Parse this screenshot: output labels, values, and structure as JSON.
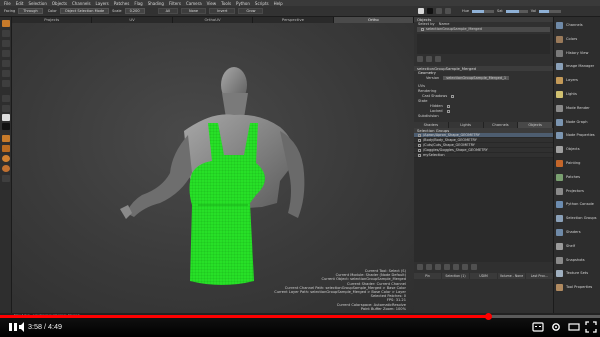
{
  "menu": [
    "File",
    "Edit",
    "Selection",
    "Objects",
    "Channels",
    "Layers",
    "Patches",
    "Flag",
    "Shading",
    "Filters",
    "Camera",
    "View",
    "Tools",
    "Python",
    "Scripts",
    "Help"
  ],
  "toolbar": {
    "facing_label": "Facing",
    "facing_value": "Through",
    "color_label": "Color",
    "color_value": "Object Selection Mode",
    "scale_label": "Scale",
    "scale_value": "0.200",
    "seg_all": "All",
    "seg_none": "None",
    "seg_invert": "Invert",
    "seg_grow": "Grow"
  },
  "right_toolbar": {
    "hue_label": "Hue",
    "sat_label": "Sat",
    "val_label": "Val",
    "hue": 0.55,
    "sat": 0.6,
    "val": 0.45
  },
  "view_tabs": [
    {
      "label": "Projects"
    },
    {
      "label": "UV"
    },
    {
      "label": "OrthoUV"
    },
    {
      "label": "Perspective"
    },
    {
      "label": "Ortho"
    }
  ],
  "active_tab": 4,
  "hud": [
    "Current Tool: Select (S)",
    "Current Module: Shader (Node Default)",
    "Current Object: selectionGroupSample_Merged",
    "Current Shader: Current Channel",
    "Current Channel Path: selectionGroupSample_Merged > Base Color",
    "Current Layer Path: selectionGroupSample_Merged > Base Color > Layer",
    "Selected Patches: 0",
    "FPS: 31.21",
    "Current Colorspace: AutomaticResolve",
    "Paint Buffer Zoom: 100%"
  ],
  "objects_panel": {
    "title": "Objects",
    "filter_label": "Select by",
    "filter_value": "Name",
    "item": "selectionGroupSample_Merged"
  },
  "props": {
    "title": "selectionGroupSample_Merged",
    "geometry_label": "Geometry",
    "version_label": "Version",
    "version_value": "selectionGroupSample_Merged_1",
    "uvs_label": "UVs",
    "rendering_label": "Rendering",
    "cast_shadows_label": "Cast Shadows",
    "state_label": "State",
    "hidden_label": "Hidden",
    "locked_label": "Locked",
    "subdivision_label": "Subdivision"
  },
  "sub_tabs": [
    {
      "label": "Shaders"
    },
    {
      "label": "Lights"
    },
    {
      "label": "Channels"
    },
    {
      "label": "Objects"
    }
  ],
  "selection_groups": {
    "title": "Selection Groups",
    "items": [
      {
        "label": "/Apron/Apron_Shape_GEOMETRY",
        "selected": true
      },
      {
        "label": "/Body/Body_Shape_GEOMETRY",
        "selected": false
      },
      {
        "label": "/Cuts/Cuts_Shape_GEOMETRY",
        "selected": false
      },
      {
        "label": "/Goggles/Goggles_Shape_GEOMETRY",
        "selected": false
      },
      {
        "label": "mySelection",
        "selected": false
      }
    ]
  },
  "footer_buttons": [
    "Pin",
    "Selection (1)",
    "UDIM",
    "Volume - None",
    "Last Proc..."
  ],
  "shelf": [
    {
      "label": "Channels",
      "icon": "channels-icon",
      "color": "#6f8aa8"
    },
    {
      "label": "Colors",
      "icon": "colors-icon",
      "color": "#9a7a5a"
    },
    {
      "label": "History View",
      "icon": "history-icon",
      "color": "#7a7a7a"
    },
    {
      "label": "Image Manager",
      "icon": "image-manager-icon",
      "color": "#8aa0b8"
    },
    {
      "label": "Layers",
      "icon": "layers-icon",
      "color": "#c49a58"
    },
    {
      "label": "Lights",
      "icon": "lights-icon",
      "color": "#d0c070"
    },
    {
      "label": "Mode Render",
      "icon": "render-icon",
      "color": "#8a8a8a"
    },
    {
      "label": "Node Graph",
      "icon": "node-graph-icon",
      "color": "#7b95b1"
    },
    {
      "label": "Node Properties",
      "icon": "node-properties-icon",
      "color": "#7b95b1"
    },
    {
      "label": "Objects",
      "icon": "objects-icon",
      "color": "#a0a0a0"
    },
    {
      "label": "Painting",
      "icon": "painting-icon",
      "color": "#c4662a"
    },
    {
      "label": "Patches",
      "icon": "patches-icon",
      "color": "#7aa070"
    },
    {
      "label": "Projectors",
      "icon": "projectors-icon",
      "color": "#8a8a8a"
    },
    {
      "label": "Python Console",
      "icon": "python-icon",
      "color": "#6c8cb0"
    },
    {
      "label": "Selection Groups",
      "icon": "selection-groups-icon",
      "color": "#8aa0b8"
    },
    {
      "label": "Shaders",
      "icon": "shaders-icon",
      "color": "#6f8aa8"
    },
    {
      "label": "Shelf",
      "icon": "shelf-icon",
      "color": "#9a9a9a"
    },
    {
      "label": "Snapshots",
      "icon": "snapshots-icon",
      "color": "#8a8a8a"
    },
    {
      "label": "Texture Sets",
      "icon": "texture-sets-icon",
      "color": "#a0b0c0"
    },
    {
      "label": "Tool Properties",
      "icon": "tool-properties-icon",
      "color": "#b08a60"
    }
  ],
  "status_left": "Mari 4.0v1 · selectionGroupSample_Merged",
  "video": {
    "time": "3:58 / 4:49",
    "progress": 0.8125
  }
}
